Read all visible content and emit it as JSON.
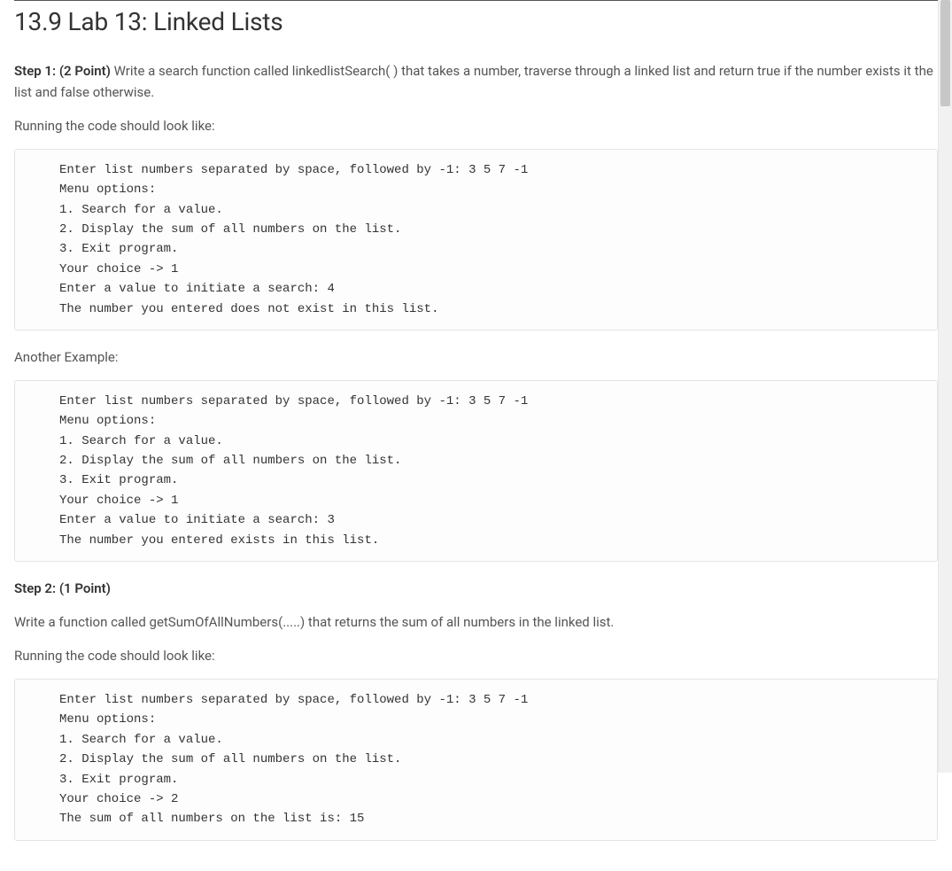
{
  "title": "13.9 Lab 13: Linked Lists",
  "step1": {
    "label": "Step 1: (2 Point) ",
    "description": "Write a search function called linkedlistSearch( ) that takes a number, traverse through a linked list and return true if the number exists it the list and false otherwise.",
    "running_note": "Running the code should look like:",
    "example1": "Enter list numbers separated by space, followed by -1: 3 5 7 -1\nMenu options:\n1. Search for a value.\n2. Display the sum of all numbers on the list.\n3. Exit program.\nYour choice -> 1\nEnter a value to initiate a search: 4\nThe number you entered does not exist in this list.",
    "another_label": "Another Example:",
    "example2": "Enter list numbers separated by space, followed by -1: 3 5 7 -1\nMenu options:\n1. Search for a value.\n2. Display the sum of all numbers on the list.\n3. Exit program.\nYour choice -> 1\nEnter a value to initiate a search: 3\nThe number you entered exists in this list."
  },
  "step2": {
    "label": "Step 2: (1 Point)",
    "description": "Write a function called getSumOfAllNumbers(.....) that returns the sum of all numbers in the linked list.",
    "running_note": "Running the code should look like:",
    "example1": "Enter list numbers separated by space, followed by -1: 3 5 7 -1\nMenu options:\n1. Search for a value.\n2. Display the sum of all numbers on the list.\n3. Exit program.\nYour choice -> 2\nThe sum of all numbers on the list is: 15"
  }
}
